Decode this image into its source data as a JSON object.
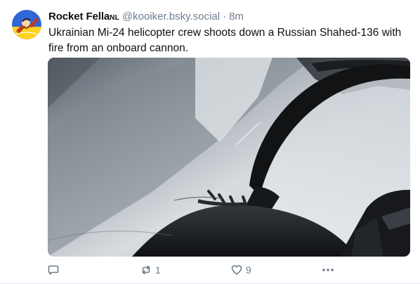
{
  "post": {
    "author": {
      "display_name": "Rocket Fella",
      "name_suffix": "NL",
      "handle": "@kooiker.bsky.social",
      "separator": "·",
      "time": "8m"
    },
    "text": "Ukrainian Mi-24 helicopter crew shoots down a Russian Shahed-136 with fire from an onboard cannon.",
    "media": {
      "type": "video-thumbnail"
    },
    "actions": {
      "reply_icon": "speech-bubble-icon",
      "repost_icon": "repost-arrows-icon",
      "repost_count": "1",
      "like_icon": "heart-icon",
      "like_count": "9",
      "more_icon": "ellipsis-icon"
    }
  },
  "colors": {
    "text": "#0b0f14",
    "muted": "#6f7d8c",
    "avatar_bg": "#2f67d8",
    "avatar_flag_yellow": "#ffd21f"
  }
}
